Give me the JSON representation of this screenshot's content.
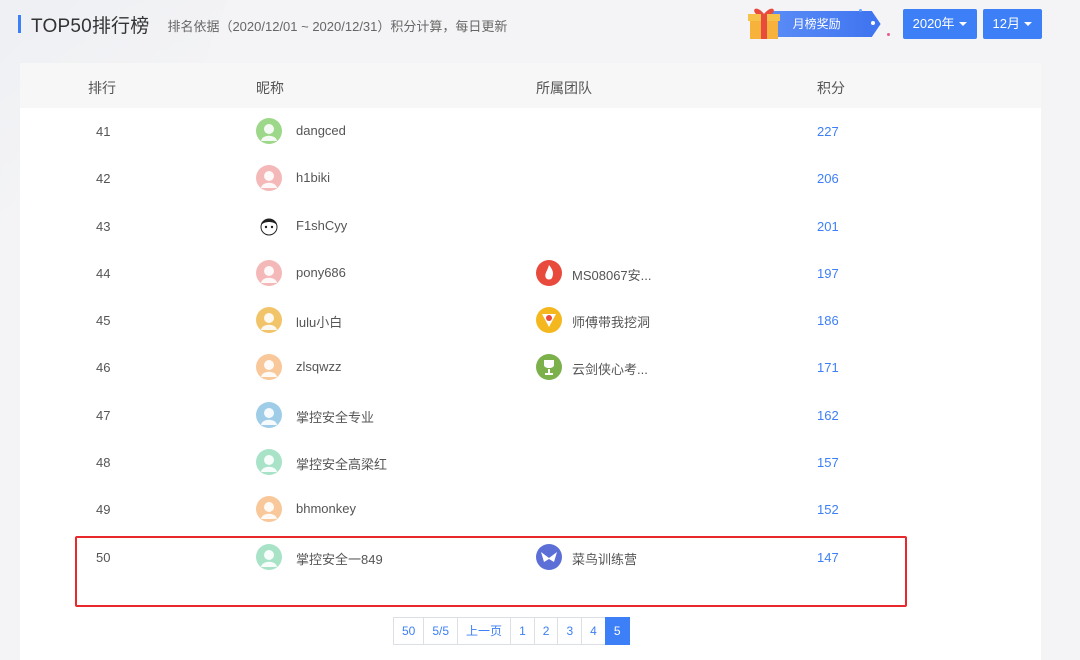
{
  "header": {
    "title": "TOP50排行榜",
    "subtitle": "排名依据（2020/12/01 ~ 2020/12/31）积分计算，每日更新",
    "award_label": "月榜奖励",
    "year_select": "2020年",
    "month_select": "12月"
  },
  "table": {
    "columns": [
      "排行",
      "昵称",
      "所属团队",
      "积分"
    ],
    "rows": [
      {
        "rank": "41",
        "nickname": "dangced",
        "team": "",
        "score": "227",
        "avatar_color": "#9dd88a",
        "team_icon": ""
      },
      {
        "rank": "42",
        "nickname": "h1biki",
        "team": "",
        "score": "206",
        "avatar_color": "#f5b8b8",
        "team_icon": ""
      },
      {
        "rank": "43",
        "nickname": "F1shCyy",
        "team": "",
        "score": "201",
        "avatar_color": "#ffffff",
        "team_icon": ""
      },
      {
        "rank": "44",
        "nickname": "pony686",
        "team": "MS08067安...",
        "score": "197",
        "avatar_color": "#f5b8b8",
        "team_icon": "flame"
      },
      {
        "rank": "45",
        "nickname": "lulu小白",
        "team": "师傅带我挖洞",
        "score": "186",
        "avatar_color": "#f2c46a",
        "team_icon": "badge"
      },
      {
        "rank": "46",
        "nickname": "zlsqwzz",
        "team": "云剑侠心考...",
        "score": "171",
        "avatar_color": "#f8c79a",
        "team_icon": "trophy"
      },
      {
        "rank": "47",
        "nickname": "掌控安全专业",
        "team": "",
        "score": "162",
        "avatar_color": "#9fcde8",
        "team_icon": ""
      },
      {
        "rank": "48",
        "nickname": "掌控安全高梁红",
        "team": "",
        "score": "157",
        "avatar_color": "#a8e3c8",
        "team_icon": ""
      },
      {
        "rank": "49",
        "nickname": "bhmonkey",
        "team": "",
        "score": "152",
        "avatar_color": "#f8c79a",
        "team_icon": ""
      },
      {
        "rank": "50",
        "nickname": "掌控安全一849",
        "team": "菜鸟训练营",
        "score": "147",
        "avatar_color": "#a8e3c8",
        "team_icon": "bird"
      }
    ]
  },
  "pager": {
    "page_size": "50",
    "page_info": "5/5",
    "prev": "上一页",
    "pages": [
      "1",
      "2",
      "3",
      "4",
      "5"
    ],
    "current": "5"
  },
  "colors": {
    "accent": "#3d7ff6",
    "highlight": "#e8282b"
  }
}
